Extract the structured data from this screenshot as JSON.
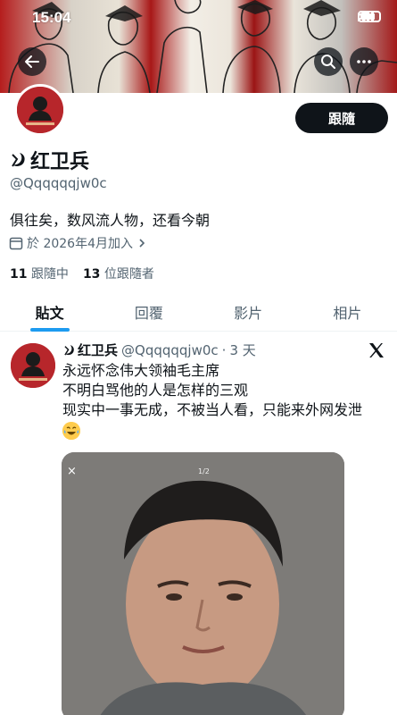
{
  "status_bar": {
    "time": "15:04"
  },
  "header": {
    "back_icon": "arrow-left-icon",
    "search_icon": "search-icon",
    "more_icon": "more-icon"
  },
  "profile": {
    "follow_label": "跟隨",
    "display_name": "红卫兵",
    "handle": "@Qqqqqqjw0c",
    "bio": "俱往矣，数风流人物，还看今朝",
    "joined": "於 2026年4月加入",
    "following_count": "11",
    "following_label": "跟隨中",
    "followers_count": "13",
    "followers_label": "位跟隨者"
  },
  "tabs": [
    {
      "label": "貼文",
      "active": true
    },
    {
      "label": "回覆",
      "active": false
    },
    {
      "label": "影片",
      "active": false
    },
    {
      "label": "相片",
      "active": false
    }
  ],
  "tweet": {
    "name": "红卫兵",
    "handle": "@Qqqqqqjw0c",
    "separator": "·",
    "time": "3 天",
    "lines": [
      "永远怀念伟大领袖毛主席",
      "不明白骂他的人是怎样的三观",
      "现实中一事无成，不被当人看，只能来外网发泄"
    ],
    "emoji": "laughing-with-tears-emoji",
    "media": {
      "close": "×",
      "counter": "1/2"
    }
  },
  "colors": {
    "accent": "#1d9bf0",
    "text": "#0f1419",
    "muted": "#536471",
    "button_bg": "#0f1419",
    "avatar_red": "#b7262b"
  }
}
